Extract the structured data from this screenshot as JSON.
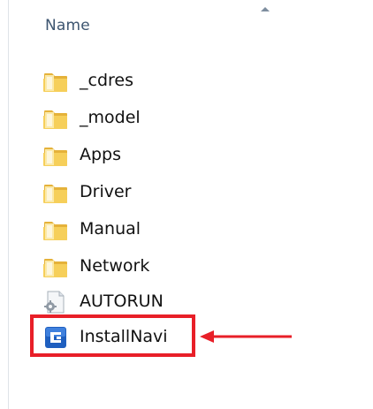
{
  "header": {
    "column_name": "Name",
    "sort_indicator_icon": "sort-ascending-icon"
  },
  "files": [
    {
      "name": "_cdres",
      "type": "folder",
      "icon": "folder-icon"
    },
    {
      "name": "_model",
      "type": "folder",
      "icon": "folder-icon"
    },
    {
      "name": "Apps",
      "type": "folder",
      "icon": "folder-icon"
    },
    {
      "name": "Driver",
      "type": "folder",
      "icon": "folder-icon"
    },
    {
      "name": "Manual",
      "type": "folder",
      "icon": "folder-icon"
    },
    {
      "name": "Network",
      "type": "folder",
      "icon": "folder-icon"
    },
    {
      "name": "AUTORUN",
      "type": "settings-file",
      "icon": "settings-file-icon"
    },
    {
      "name": "InstallNavi",
      "type": "application",
      "icon": "application-icon",
      "highlighted": true
    }
  ],
  "annotation": {
    "highlight_color": "#e81f28",
    "arrow_color": "#e81f28",
    "arrow_direction": "left"
  },
  "colors": {
    "header_text": "#3d5570",
    "item_text": "#111111",
    "folder_yellow": "#f2c44a",
    "app_icon_blue": "#1f5fbf"
  }
}
